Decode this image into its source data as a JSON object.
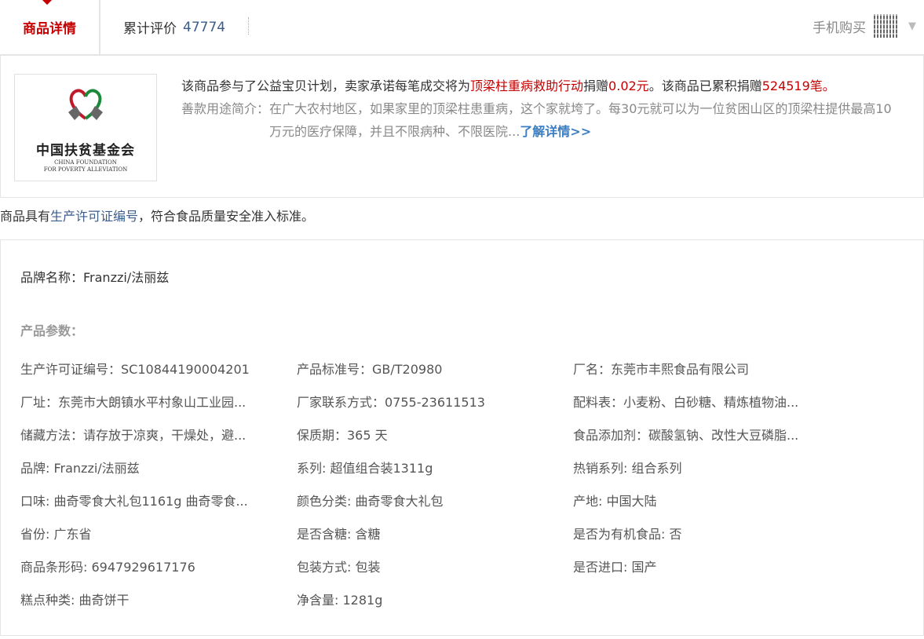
{
  "tabs": {
    "details_label": "商品详情",
    "reviews_label": "累计评价",
    "reviews_count": "47774",
    "mobile_buy_label": "手机购买"
  },
  "charity": {
    "logo_text_cn": "中国扶贫基金会",
    "logo_text_en_1": "CHINA FOUNDATION",
    "logo_text_en_2": "FOR POVERTY ALLEVIATION",
    "line1_a": "该商品参与了公益宝贝计划，卖家承诺每笔成交将为",
    "line1_project": "顶梁柱重病救助行动",
    "line1_b": "捐赠",
    "line1_amount": "0.02元",
    "line1_c": "。该商品已累积捐赠",
    "line1_total": "524519",
    "line1_d": "笔。",
    "usage_label": "善款用途简介：",
    "usage_text": "在广大农村地区，如果家里的顶梁柱患重病，这个家就垮了。每30元就可以为一位贫困山区的顶梁柱提供最高10万元的医疗保障，并且不限病种、不限医院...",
    "more_link": "了解详情>>"
  },
  "license": {
    "prefix": "商品具有",
    "link": "生产许可证编号",
    "suffix": "，符合食品质量安全准入标准。"
  },
  "params": {
    "brand_name": "品牌名称：Franzzi/法丽兹",
    "title": "产品参数：",
    "rows": [
      [
        "生产许可证编号：SC10844190004201",
        "产品标准号：GB/T20980",
        "厂名：东莞市丰熙食品有限公司"
      ],
      [
        "厂址：东莞市大朗镇水平村象山工业园...",
        "厂家联系方式：0755-23611513",
        "配料表：小麦粉、白砂糖、精炼植物油..."
      ],
      [
        "储藏方法：请存放于凉爽，干燥处，避...",
        "保质期：365 天",
        "食品添加剂：碳酸氢钠、改性大豆磷脂..."
      ],
      [
        "品牌: Franzzi/法丽兹",
        "系列: 超值组合装1311g",
        "热销系列: 组合系列"
      ],
      [
        "口味: 曲奇零食大礼包1161g 曲奇零食...",
        "颜色分类: 曲奇零食大礼包",
        "产地: 中国大陆"
      ],
      [
        "省份: 广东省",
        "是否含糖: 含糖",
        "是否为有机食品: 否"
      ],
      [
        "商品条形码: 6947929617176",
        "包装方式: 包装",
        "是否进口: 国产"
      ],
      [
        "糕点种类: 曲奇饼干",
        "净含量: 1281g",
        ""
      ]
    ]
  },
  "colors": {
    "accent": "#c40000",
    "link": "#3c5c8a",
    "more": "#3c7ec2"
  },
  "icons": {
    "qr": "qr-code-icon",
    "chevron": "chevron-down-icon"
  }
}
